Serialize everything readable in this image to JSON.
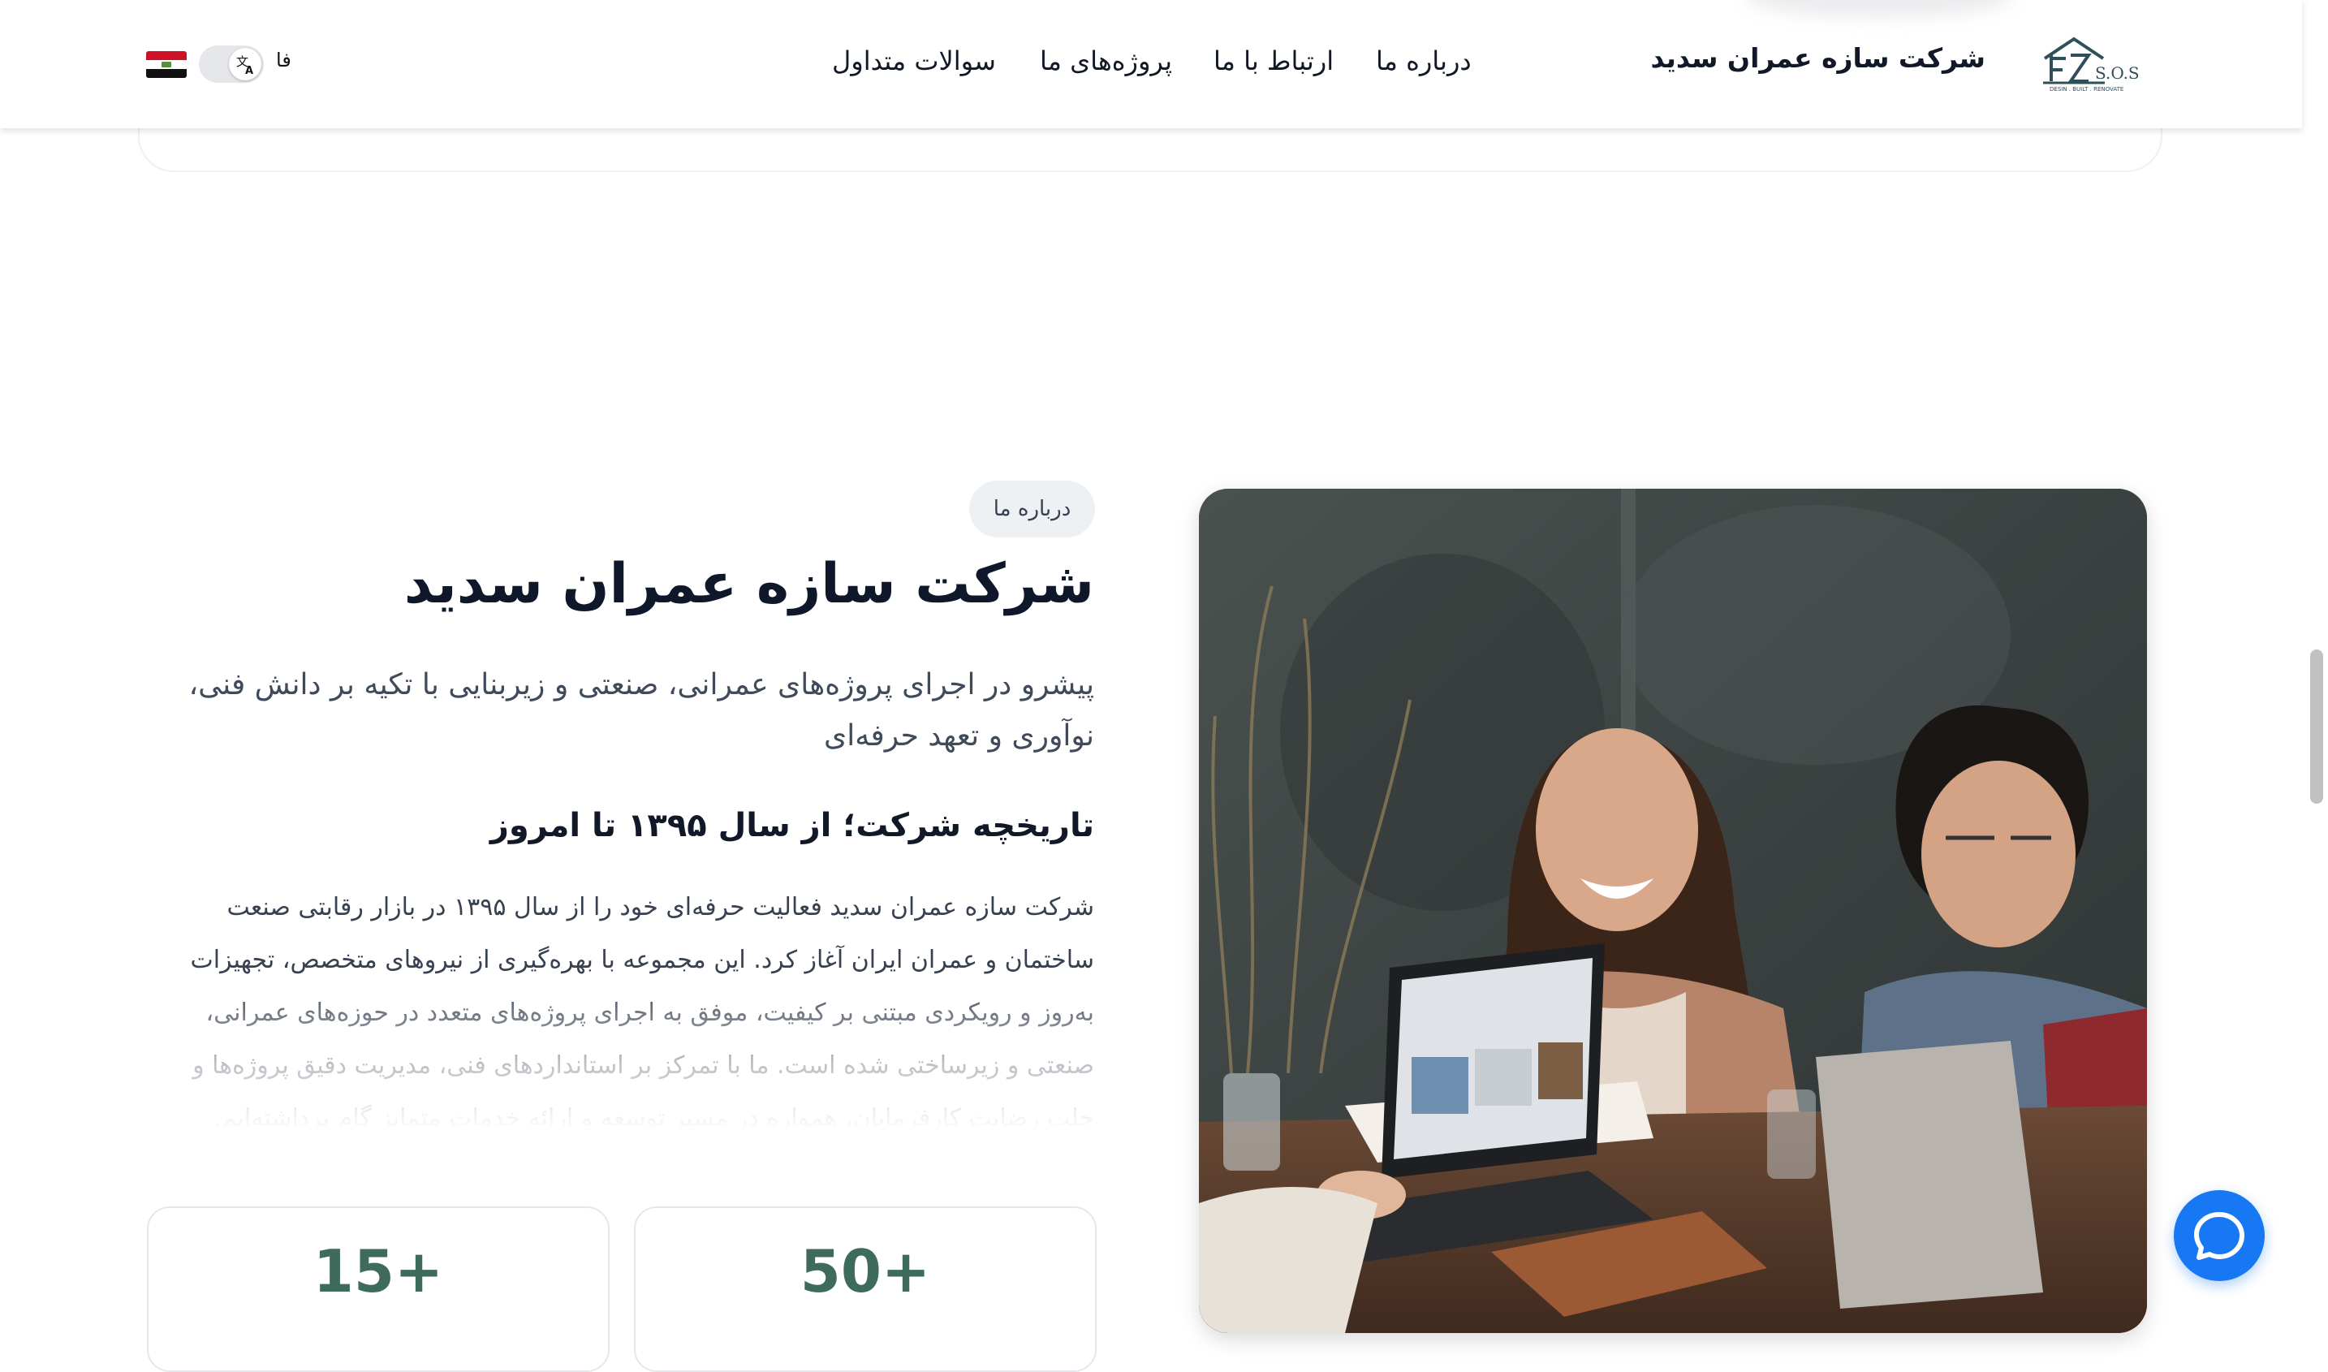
{
  "header": {
    "brand": "شرکت سازه عمران سدید",
    "logo_text": "S.O.S",
    "logo_tagline": "DESIN . BUILT . RENOVATE",
    "nav": [
      "درباره ما",
      "ارتباط با ما",
      "پروژه‌های ما",
      "سوالات متداول"
    ],
    "lang_label": "فا",
    "toggle_icon": "translate-icon",
    "flag_icon": "iraq-flag-icon"
  },
  "about": {
    "chip": "درباره ما",
    "title": "شرکت سازه عمران سدید",
    "lead": "پیشرو در اجرای پروژه‌های عمرانی، صنعتی و زیربنایی با تکیه بر دانش فنی، نوآوری و تعهد حرفه‌ای",
    "history_title": "تاریخچه شرکت؛ از سال ۱۳۹۵ تا امروز",
    "history_body": "شرکت سازه عمران سدید فعالیت حرفه‌ای خود را از سال ۱۳۹۵ در بازار رقابتی صنعت ساختمان و عمران ایران آغاز کرد. این مجموعه با بهره‌گیری از نیروهای متخصص، تجهیزات به‌روز و رویکردی مبتنی بر کیفیت، موفق به اجرای پروژه‌های متعدد در حوزه‌های عمرانی، صنعتی و زیرساختی شده است. ما با تمرکز بر استانداردهای فنی، مدیریت دقیق پروژه‌ها و جلب رضایت کارفرمایان، همواره در مسیر توسعه و ارائه خدمات متمایز گام برداشته‌ایم.",
    "stats": [
      "15+",
      "50+"
    ]
  },
  "colors": {
    "accent": "#3f6b5c",
    "chat_button": "#1877f2",
    "chip_bg": "#eef1f4"
  },
  "chat_icon": "chat-bubble-icon"
}
